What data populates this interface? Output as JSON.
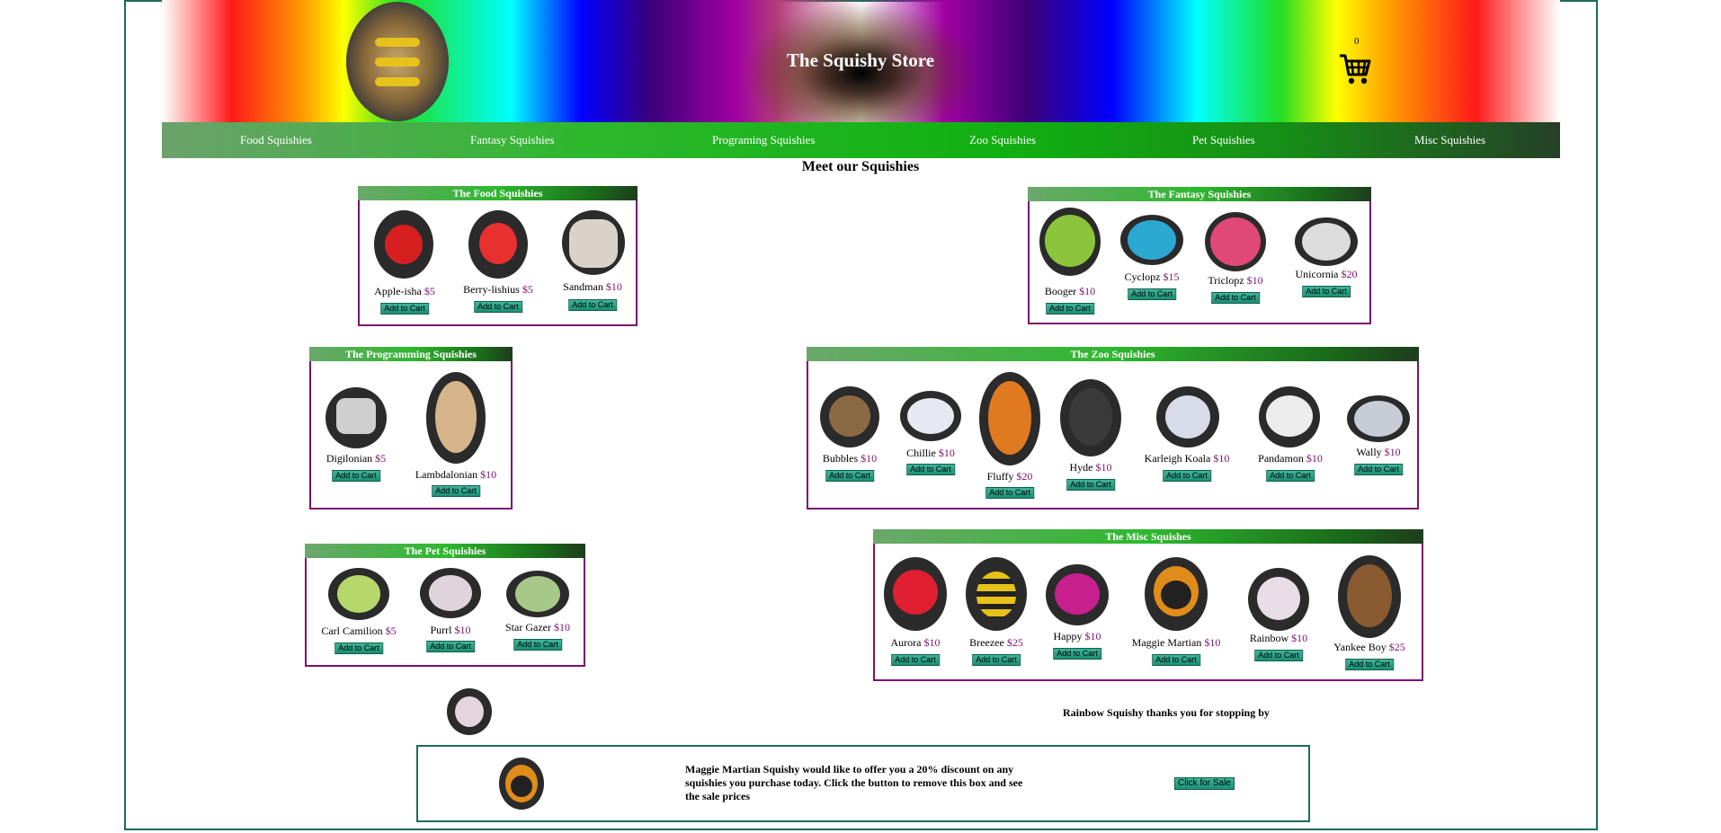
{
  "header": {
    "title": "The Squishy Store",
    "cart_count": "0",
    "logo_icon": "bee-squishy-logo",
    "cart_icon": "cart-icon"
  },
  "nav": [
    "Food Squishies",
    "Fantasy Squishies",
    "Programing Squishies",
    "Zoo Squishies",
    "Pet Squishies",
    "Misc Squishies"
  ],
  "meet_heading": "Meet our Squishies",
  "add_label": "Add to Cart",
  "sections": {
    "food": {
      "title": "The Food Squishies",
      "items": [
        {
          "name": "Apple-isha",
          "price": "$5"
        },
        {
          "name": "Berry-lishius",
          "price": "$5"
        },
        {
          "name": "Sandman",
          "price": "$10"
        }
      ]
    },
    "fantasy": {
      "title": "The Fantasy Squishies",
      "items": [
        {
          "name": "Booger",
          "price": "$10"
        },
        {
          "name": "Cyclopz",
          "price": "$15"
        },
        {
          "name": "Triclopz",
          "price": "$10"
        },
        {
          "name": "Unicornia",
          "price": "$20"
        }
      ]
    },
    "programming": {
      "title": "The Programming Squishies",
      "items": [
        {
          "name": "Digilonian",
          "price": "$5"
        },
        {
          "name": "Lambdalonian",
          "price": "$10"
        }
      ]
    },
    "zoo": {
      "title": "The Zoo Squishies",
      "items": [
        {
          "name": "Bubbles",
          "price": "$10"
        },
        {
          "name": "Chillie",
          "price": "$10"
        },
        {
          "name": "Fluffy",
          "price": "$20"
        },
        {
          "name": "Hyde",
          "price": "$10"
        },
        {
          "name": "Karleigh Koala",
          "price": "$10"
        },
        {
          "name": "Pandamon",
          "price": "$10"
        },
        {
          "name": "Wally",
          "price": "$10"
        }
      ]
    },
    "pet": {
      "title": "The Pet Squishies",
      "items": [
        {
          "name": "Carl Camilion",
          "price": "$5"
        },
        {
          "name": "Purrl",
          "price": "$10"
        },
        {
          "name": "Star Gazer",
          "price": "$10"
        }
      ]
    },
    "misc": {
      "title": "The Misc Squishes",
      "items": [
        {
          "name": "Aurora",
          "price": "$10"
        },
        {
          "name": "Breezee",
          "price": "$25"
        },
        {
          "name": "Happy",
          "price": "$10"
        },
        {
          "name": "Maggie Martian",
          "price": "$10"
        },
        {
          "name": "Rainbow",
          "price": "$10"
        },
        {
          "name": "Yankee Boy",
          "price": "$25"
        }
      ]
    }
  },
  "thanks_text": "Rainbow Squishy thanks you for stopping by",
  "sale": {
    "text": "Maggie Martian Squishy would like to offer you a 20% discount on any squishies you purchase today. Click the button to remove this box and see the sale prices",
    "button_label": "Click for Sale"
  },
  "colors": {
    "price": "#7a1070",
    "box_border": "#7a1070",
    "frame_border": "#1f6b57",
    "button": "#2a9f85"
  }
}
